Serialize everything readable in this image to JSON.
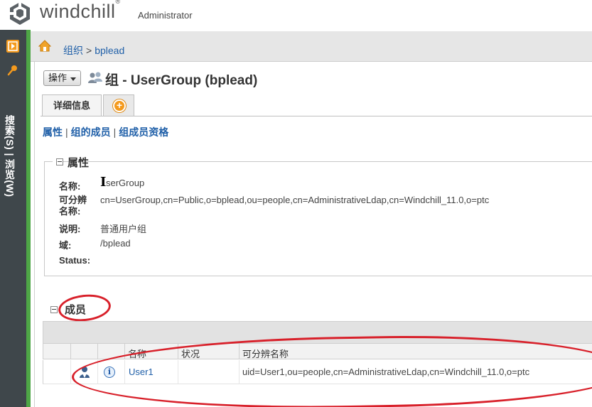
{
  "header": {
    "brand": "windchill",
    "trademark": "®",
    "role": "Administrator"
  },
  "sidebar": {
    "vertical_label": "搜索(S) | 浏览(W)"
  },
  "breadcrumb": {
    "org": "组织",
    "separator": ">",
    "current": "bplead"
  },
  "page": {
    "actions_label": "操作",
    "title": "组 - UserGroup (bplead)"
  },
  "tabs": {
    "details": "详细信息",
    "add_symbol": "+"
  },
  "subnav": {
    "attributes": "属性",
    "members": "组的成员",
    "memberships": "组成员资格",
    "separator": "|"
  },
  "attributes": {
    "section_title": "属性",
    "rows": [
      {
        "label": "名称:",
        "value": "serGroup"
      },
      {
        "label": "可分辨名称:",
        "value": "cn=UserGroup,cn=Public,o=bplead,ou=people,cn=AdministrativeLdap,cn=Windchill_11.0,o=ptc"
      },
      {
        "label": "说明:",
        "value": "普通用户组"
      },
      {
        "label": "域:",
        "value": "/bplead"
      },
      {
        "label": "Status:",
        "value": ""
      }
    ],
    "cursor_glyph": "I"
  },
  "members": {
    "section_title": "成员",
    "columns": [
      "名称",
      "状况",
      "可分辨名称"
    ],
    "rows": [
      {
        "name": "User1",
        "status": "",
        "dn": "uid=User1,ou=people,cn=AdministrativeLdap,cn=Windchill_11.0,o=ptc",
        "info_glyph": "i"
      }
    ]
  },
  "colors": {
    "sidebar_bg": "#3f474b",
    "green_accent": "#4ea646",
    "link_blue": "#1f5fa8",
    "annotation_red": "#d8202a",
    "orange_accent": "#f49a1d"
  },
  "icons": [
    "windchill-logo-icon",
    "navigator-expand-icon",
    "search-pin-icon",
    "home-icon",
    "group-icon",
    "add-tab-icon",
    "collapse-icon",
    "user-icon",
    "info-icon",
    "text-cursor-icon"
  ]
}
